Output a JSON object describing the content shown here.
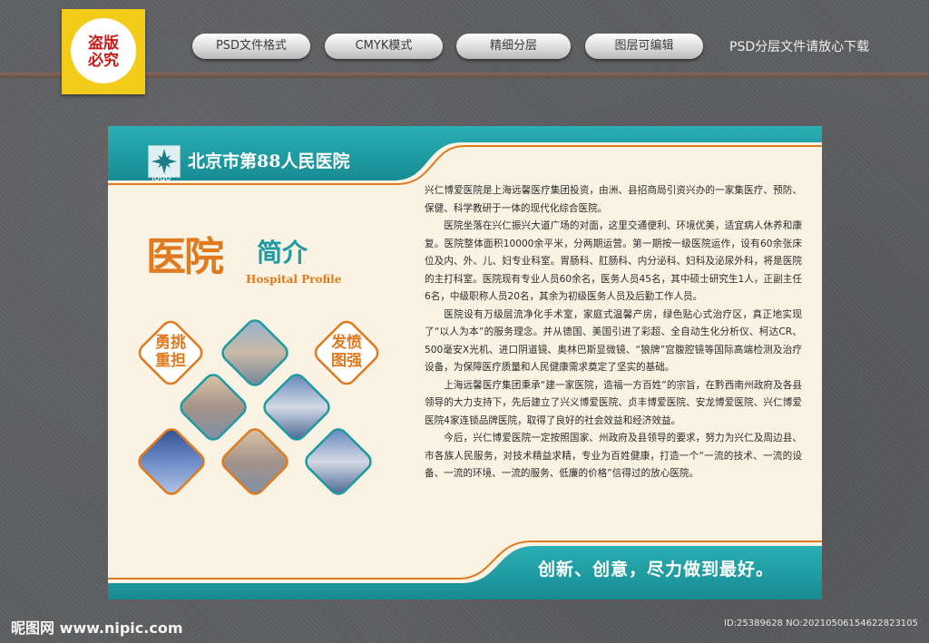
{
  "watermark": {
    "badge_text": "盗版\n必究"
  },
  "tabs": [
    {
      "label": "PSD文件格式"
    },
    {
      "label": "CMYK模式"
    },
    {
      "label": "精细分层"
    },
    {
      "label": "图层可编辑"
    }
  ],
  "tab_note": "PSD分层文件请放心下载",
  "board": {
    "hospital_name": "北京市第88人民医院",
    "logo_text": "logo",
    "title_cn_part1": "医院",
    "title_cn_part2": "简介",
    "title_en": "Hospital Profile",
    "slogan_left": "勇挑\n重担",
    "slogan_right": "发愤\n图强",
    "paragraphs": [
      "兴仁博爱医院是上海远馨医疗集团投资，由洲、县招商局引资兴办的一家集医疗、预防、保健、科学教研于一体的现代化综合医院。",
      "医院坐落在兴仁振兴大道广场的对面，这里交通便利、环境优美，适宜病人休养和康复。医院整体面积10000余平米，分两期运营。第一期按一级医院运作，设有60余张床位及内、外、儿、妇专业科室。胃肠科、肛肠科、内分泌科、妇科及泌尿外科，将是医院的主打科室。医院现有专业人员60余名，医务人员45名，其中硕士研究生1人，正副主任6名，中级职称人员20名，其余为初级医务人员及后勤工作人员。",
      "医院设有万级层流净化手术室，家庭式温馨产房，绿色贴心式治疗区，真正地实现了“以人为本”的服务理念。并从德国、美国引进了彩超、全自动生化分析仪、柯达CR、500毫安X光机、进口阴道镜、奥林巴斯显微镜、“狼牌”宫腹腔镜等国际高端检测及治疗设备，为保障医疗质量和人民健康需求奠定了坚实的基础。",
      "上海远馨医疗集团秉承“建一家医院，造福一方百姓”的宗旨，在黔西南州政府及各县领导的大力支持下，先后建立了兴义博爱医院、贞丰博爱医院、安龙博爱医院、兴仁博爱医院4家连锁品牌医院，取得了良好的社会效益和经济效益。",
      "今后，兴仁博爱医院一定按照国家、州政府及县领导的要求，努力为兴仁及周边县、市各族人民服务，对技术精益求精，专业为百姓健康，打造一个“一流的技术、一流的设备、一流的环境、一流的服务、低廉的价格”信得过的放心医院。"
    ],
    "motto": "创新、创意，尽力做到最好。"
  },
  "footer": {
    "site": "昵图网 www.nipic.com",
    "id_text": "ID:25389628 NO:20210506154622823105"
  },
  "colors": {
    "teal": "#1e9aa0",
    "orange": "#e07a1f",
    "cream": "#faf3e3",
    "badge_yellow": "#f2cc19",
    "badge_red": "#c91d1d"
  }
}
